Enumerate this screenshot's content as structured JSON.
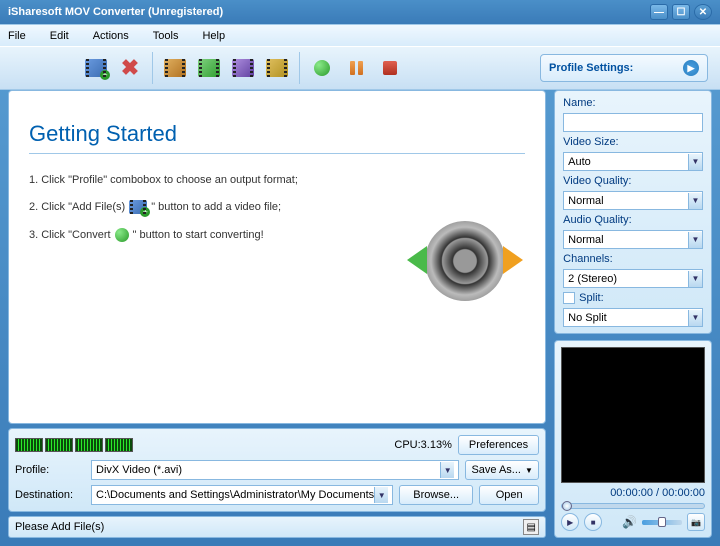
{
  "window": {
    "title": "iSharesoft MOV Converter (Unregistered)"
  },
  "menu": {
    "file": "File",
    "edit": "Edit",
    "actions": "Actions",
    "tools": "Tools",
    "help": "Help"
  },
  "toolbar": {
    "profile_settings": "Profile Settings:"
  },
  "getting_started": {
    "title": "Getting Started",
    "step1_a": "1. Click \"Profile\" combobox to choose an output format;",
    "step2_a": "2. Click \"Add File(s)",
    "step2_b": "\" button to add a video file;",
    "step3_a": "3. Click \"Convert",
    "step3_b": "\" button to start converting!"
  },
  "cpu": {
    "label": "CPU:3.13%"
  },
  "buttons": {
    "preferences": "Preferences",
    "save_as": "Save As...",
    "browse": "Browse...",
    "open": "Open"
  },
  "profile": {
    "label": "Profile:",
    "value": "DivX Video (*.avi)"
  },
  "destination": {
    "label": "Destination:",
    "value": "C:\\Documents and Settings\\Administrator\\My Documents"
  },
  "status": {
    "text": "Please Add File(s)"
  },
  "settings": {
    "name": {
      "label": "Name:",
      "value": ""
    },
    "video_size": {
      "label": "Video Size:",
      "value": "Auto"
    },
    "video_quality": {
      "label": "Video Quality:",
      "value": "Normal"
    },
    "audio_quality": {
      "label": "Audio Quality:",
      "value": "Normal"
    },
    "channels": {
      "label": "Channels:",
      "value": "2 (Stereo)"
    },
    "split": {
      "label": "Split:",
      "value": "No Split"
    }
  },
  "preview": {
    "time": "00:00:00 / 00:00:00"
  }
}
